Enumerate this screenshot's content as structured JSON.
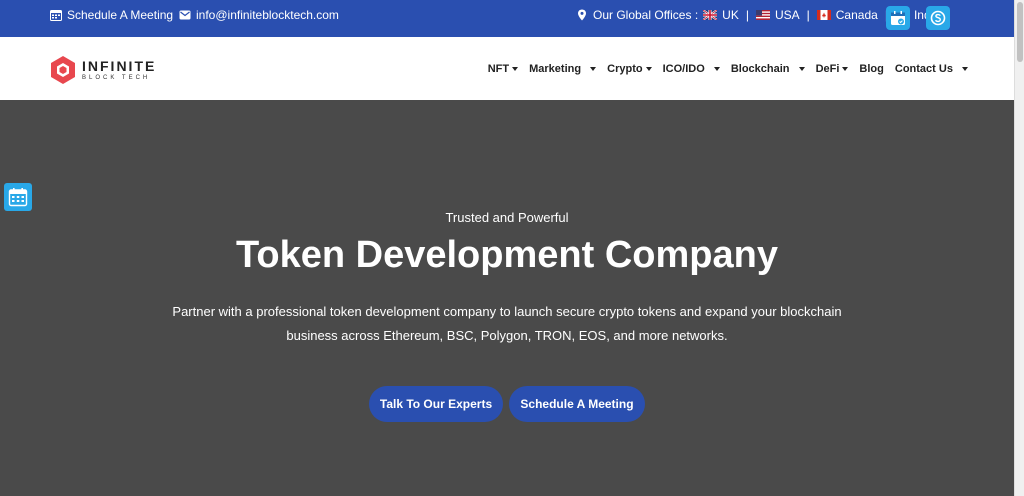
{
  "topbar": {
    "schedule_label": "Schedule A Meeting",
    "email": "info@infiniteblocktech.com",
    "offices_label": "Our Global Offices :",
    "offices": [
      "UK",
      "USA",
      "Canada",
      "India"
    ],
    "separator": "|"
  },
  "logo": {
    "main": "INFINITE",
    "sub": "BLOCK TECH"
  },
  "nav": [
    {
      "label": "NFT"
    },
    {
      "label": "Marketing"
    },
    {
      "label": "Crypto"
    },
    {
      "label": "ICO/IDO"
    },
    {
      "label": "Blockchain"
    },
    {
      "label": "DeFi"
    },
    {
      "label": "Blog"
    },
    {
      "label": "Contact Us"
    }
  ],
  "hero": {
    "subtitle": "Trusted and Powerful",
    "title": "Token Development Company",
    "description": "Partner with a professional token development company to launch secure crypto tokens and expand your blockchain business across Ethereum, BSC, Polygon, TRON, EOS, and more networks.",
    "cta_primary": "Talk To Our Experts",
    "cta_secondary": "Schedule A Meeting"
  },
  "colors": {
    "brand_blue": "#2a4fb0",
    "hero_bg": "#4a4a4a",
    "accent_cyan": "#29a8e8",
    "logo_red": "#e8474e"
  }
}
